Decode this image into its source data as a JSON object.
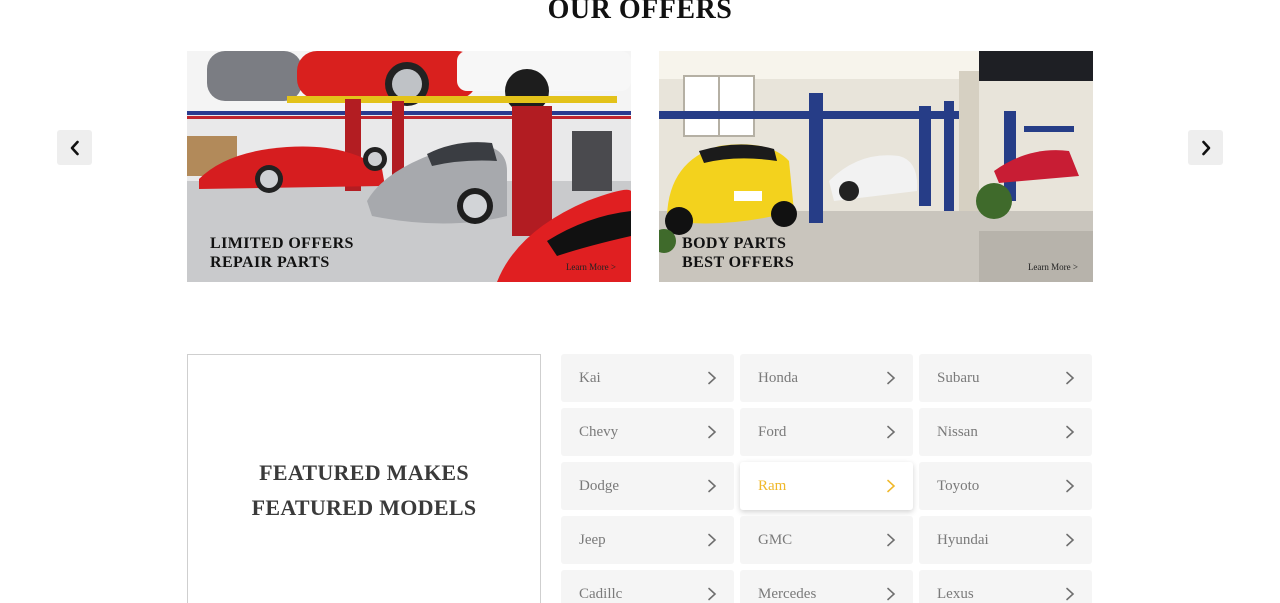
{
  "section": {
    "title": "OUR OFFERS"
  },
  "carousel": {
    "prev_icon": "chevron-left-icon",
    "next_icon": "chevron-right-icon"
  },
  "offers": [
    {
      "line1": "LIMITED OFFERS",
      "line2": "REPAIR PARTS",
      "link": "Learn More >"
    },
    {
      "line1": "BODY PARTS",
      "line2": "BEST OFFERS",
      "link": "Learn More >"
    }
  ],
  "featured": {
    "line1": "FEATURED MAKES",
    "line2": "FEATURED MODELS"
  },
  "makes": [
    {
      "label": "Kai"
    },
    {
      "label": "Honda"
    },
    {
      "label": "Subaru"
    },
    {
      "label": "Chevy"
    },
    {
      "label": "Ford"
    },
    {
      "label": "Nissan"
    },
    {
      "label": "Dodge"
    },
    {
      "label": "Ram",
      "active": true
    },
    {
      "label": "Toyoto"
    },
    {
      "label": "Jeep"
    },
    {
      "label": "GMC"
    },
    {
      "label": "Hyundai"
    },
    {
      "label": "Cadillc"
    },
    {
      "label": "Mercedes"
    },
    {
      "label": "Lexus"
    }
  ],
  "colors": {
    "active_accent": "#f0b82a",
    "tile_bg": "#f5f5f5",
    "tile_text": "#7a7a7a"
  }
}
